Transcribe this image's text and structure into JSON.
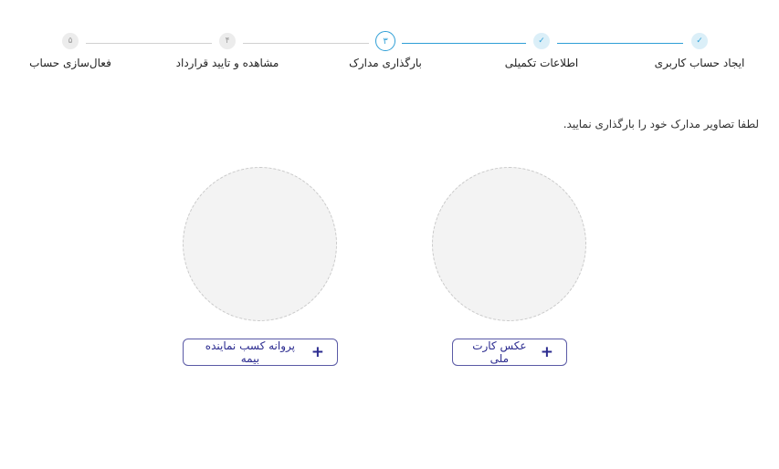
{
  "stepper": {
    "steps": [
      {
        "marker": "✓",
        "label": "ایجاد حساب کاربری",
        "state": "done"
      },
      {
        "marker": "✓",
        "label": "اطلاعات تکمیلی",
        "state": "done"
      },
      {
        "marker": "۳",
        "label": "بارگذاری مدارک",
        "state": "active"
      },
      {
        "marker": "۴",
        "label": "مشاهده و تایید قرارداد",
        "state": "todo"
      },
      {
        "marker": "۵",
        "label": "فعال‌سازی حساب",
        "state": "todo"
      }
    ]
  },
  "instruction": "لطفا تصاویر مدارک خود را بارگذاری نمایید.",
  "uploads": {
    "national_card": {
      "button_label": "عکس کارت ملی",
      "icon": "plus-icon"
    },
    "insurance_license": {
      "button_label": "پروانه کسب نماینده بیمه",
      "icon": "plus-icon"
    }
  },
  "colors": {
    "accent": "#2f9fd6",
    "button_text": "#2b2b8f",
    "button_border": "#5a5aa6",
    "inactive_line": "#d0d0d0"
  }
}
